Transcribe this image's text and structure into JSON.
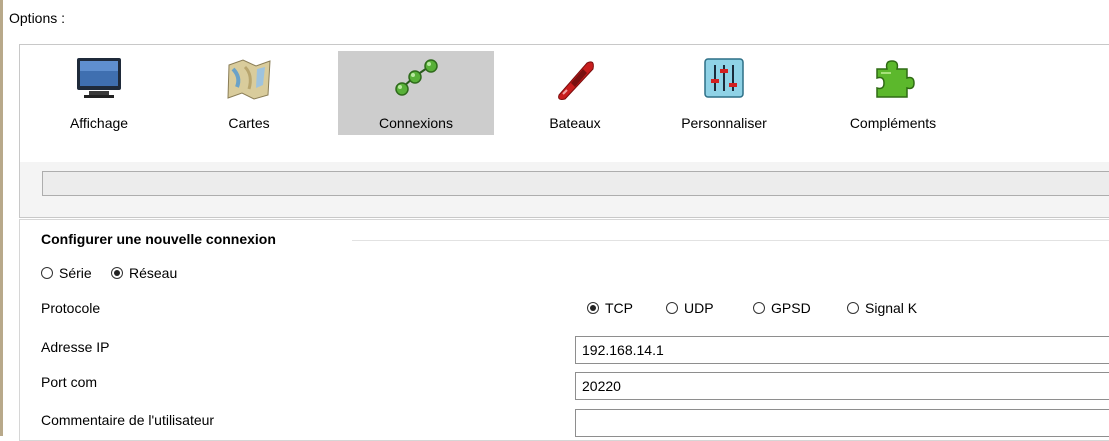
{
  "window": {
    "title": "Options :"
  },
  "toolbar": {
    "items": [
      {
        "label": "Affichage",
        "icon": "monitor-icon"
      },
      {
        "label": "Cartes",
        "icon": "chart-map-icon"
      },
      {
        "label": "Connexions",
        "icon": "connections-icon",
        "active": true
      },
      {
        "label": "Bateaux",
        "icon": "boat-icon"
      },
      {
        "label": "Personnaliser",
        "icon": "sliders-icon"
      },
      {
        "label": "Compléments",
        "icon": "puzzle-icon"
      }
    ]
  },
  "connection": {
    "title": "Configurer une nouvelle connexion",
    "type_options": [
      {
        "label": "Série",
        "checked": false
      },
      {
        "label": "Réseau",
        "checked": true
      }
    ],
    "protocol_label": "Protocole",
    "protocols": [
      {
        "label": "TCP",
        "checked": true
      },
      {
        "label": "UDP",
        "checked": false
      },
      {
        "label": "GPSD",
        "checked": false
      },
      {
        "label": "Signal K",
        "checked": false
      }
    ],
    "ip_label": "Adresse IP",
    "ip_value": "192.168.14.1",
    "port_label": "Port com",
    "port_value": "20220",
    "comment_label": "Commentaire de l'utilisateur",
    "comment_value": ""
  }
}
